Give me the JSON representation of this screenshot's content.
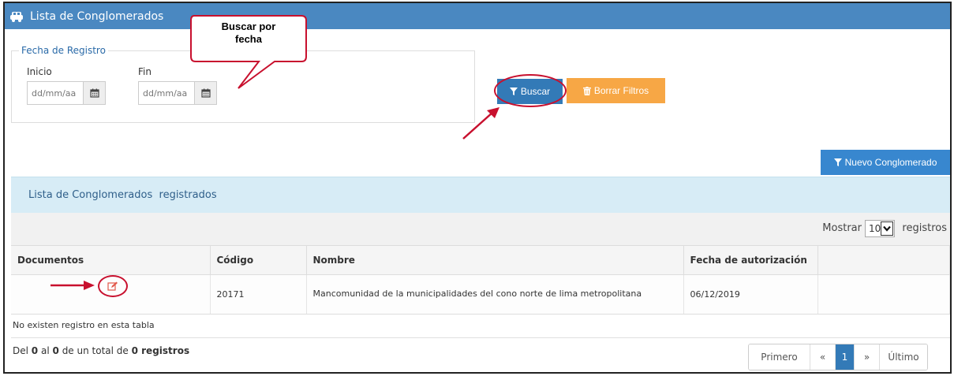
{
  "title": "Lista de Conglomerados",
  "callout": "Buscar por\nfecha",
  "filter": {
    "legend": "Fecha de Registro",
    "inicio_label": "Inicio",
    "fin_label": "Fin",
    "inicio_placeholder": "dd/mm/aa",
    "fin_placeholder": "dd/mm/aa"
  },
  "buttons": {
    "buscar": "Buscar",
    "borrar": "Borrar Filtros",
    "nuevo": "Nuevo Conglomerado"
  },
  "panel_title": "Lista de Conglomerados  registrados",
  "length_menu": {
    "mostrar": "Mostrar",
    "value": "10",
    "registros": "registros"
  },
  "table": {
    "headers": [
      "Documentos",
      "Código",
      "Nombre",
      "Fecha de autorización",
      ""
    ],
    "rows": [
      {
        "codigo": "20171",
        "nombre": "Mancomunidad de la municipalidades del cono norte de lima metropolitana",
        "fecha": "06/12/2019"
      }
    ]
  },
  "empty_text": "No existen registro en esta tabla",
  "info": {
    "del": "Del",
    "start": "0",
    "al": "al",
    "end": "0",
    "de_total": "de un total de",
    "total": "0 registros"
  },
  "pagination": {
    "primero": "Primero",
    "prev": "«",
    "current": "1",
    "next": "»",
    "ultimo": "Último"
  },
  "colors": {
    "titlebar": "#4a88c1",
    "primary": "#337ab7",
    "warning": "#f7a745",
    "annotation": "#c8102e",
    "panel_head": "#d7ecf6"
  },
  "icons": {
    "title": "car-icon",
    "calendar": "calendar-icon",
    "filter": "filter-icon",
    "trash": "trash-icon",
    "edit": "edit-icon",
    "chevron": "chevron-down-icon"
  }
}
